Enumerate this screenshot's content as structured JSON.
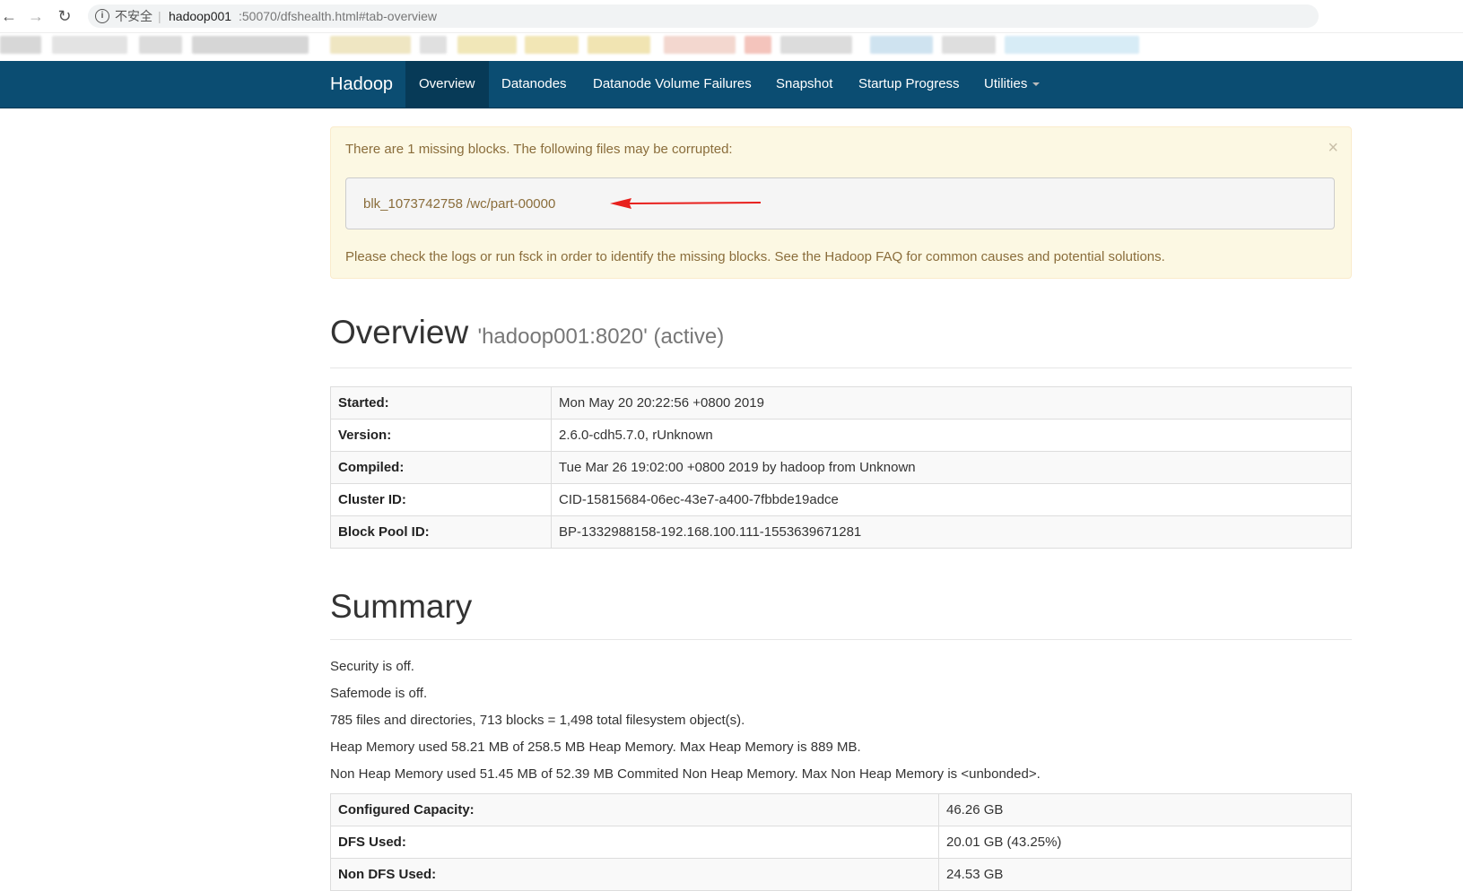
{
  "browser": {
    "insecure_label": "不安全",
    "separator": "|",
    "url_host": "hadoop001",
    "url_path": ":50070/dfshealth.html#tab-overview"
  },
  "navbar": {
    "brand": "Hadoop",
    "items": [
      {
        "label": "Overview",
        "active": true
      },
      {
        "label": "Datanodes"
      },
      {
        "label": "Datanode Volume Failures"
      },
      {
        "label": "Snapshot"
      },
      {
        "label": "Startup Progress"
      },
      {
        "label": "Utilities"
      }
    ]
  },
  "alert": {
    "message": "There are 1 missing blocks. The following files may be corrupted:",
    "close": "×",
    "block": "blk_1073742758 /wc/part-00000",
    "hint": "Please check the logs or run fsck in order to identify the missing blocks. See the Hadoop FAQ for common causes and potential solutions."
  },
  "overview": {
    "title": "Overview",
    "subtitle": "'hadoop001:8020' (active)",
    "rows": [
      {
        "key": "Started:",
        "value": "Mon May 20 20:22:56 +0800 2019"
      },
      {
        "key": "Version:",
        "value": "2.6.0-cdh5.7.0, rUnknown"
      },
      {
        "key": "Compiled:",
        "value": "Tue Mar 26 19:02:00 +0800 2019 by hadoop from Unknown"
      },
      {
        "key": "Cluster ID:",
        "value": "CID-15815684-06ec-43e7-a400-7fbbde19adce"
      },
      {
        "key": "Block Pool ID:",
        "value": "BP-1332988158-192.168.100.111-1553639671281"
      }
    ]
  },
  "summary": {
    "title": "Summary",
    "lines": [
      "Security is off.",
      "Safemode is off.",
      "785 files and directories, 713 blocks = 1,498 total filesystem object(s).",
      "Heap Memory used 58.21 MB of 258.5 MB Heap Memory. Max Heap Memory is 889 MB.",
      "Non Heap Memory used 51.45 MB of 52.39 MB Commited Non Heap Memory. Max Non Heap Memory is <unbonded>."
    ],
    "rows": [
      {
        "key": "Configured Capacity:",
        "value": "46.26 GB"
      },
      {
        "key": "DFS Used:",
        "value": "20.01 GB (43.25%)"
      },
      {
        "key": "Non DFS Used:",
        "value": "24.53 GB"
      }
    ]
  },
  "colors": {
    "navbar": "#0b4d72",
    "alert_bg": "#fcf8e3",
    "alert_text": "#8a6d3b",
    "arrow": "#e8201d"
  }
}
